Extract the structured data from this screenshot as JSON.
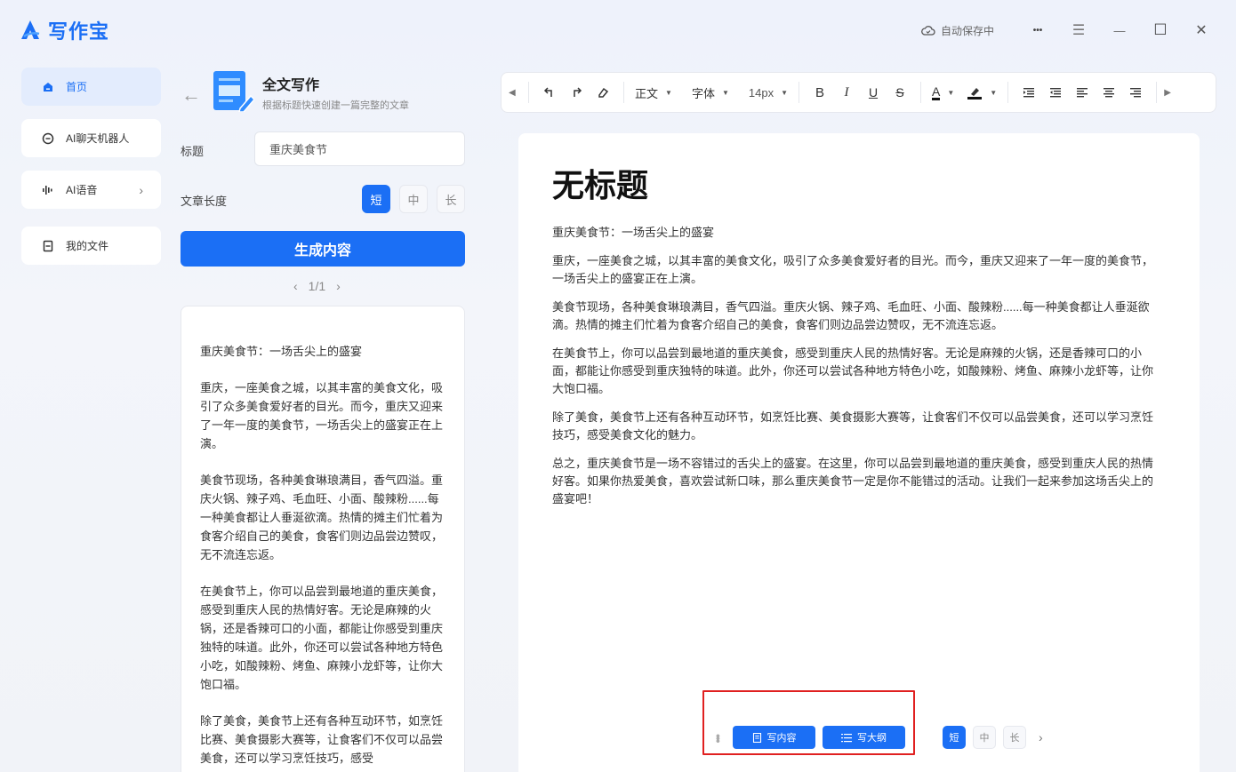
{
  "app": {
    "name": "写作宝"
  },
  "titlebar": {
    "autosave": "自动保存中",
    "more": "•••",
    "menu": "☰",
    "minimize": "—",
    "maximize": "☐",
    "close": "✕"
  },
  "sidebar": {
    "items": [
      {
        "label": "首页"
      },
      {
        "label": "AI聊天机器人"
      },
      {
        "label": "AI语音"
      },
      {
        "label": "我的文件"
      }
    ]
  },
  "panel": {
    "title": "全文写作",
    "subtitle": "根据标题快速创建一篇完整的文章",
    "title_label": "标题",
    "title_value": "重庆美食节",
    "length_label": "文章长度",
    "length_options": [
      "短",
      "中",
      "长"
    ],
    "generate_label": "生成内容",
    "pager": "1/1"
  },
  "result": {
    "paragraphs": [
      "重庆美食节：一场舌尖上的盛宴",
      "重庆，一座美食之城，以其丰富的美食文化，吸引了众多美食爱好者的目光。而今，重庆又迎来了一年一度的美食节，一场舌尖上的盛宴正在上演。",
      "美食节现场，各种美食琳琅满目，香气四溢。重庆火锅、辣子鸡、毛血旺、小面、酸辣粉......每一种美食都让人垂涎欲滴。热情的摊主们忙着为食客介绍自己的美食，食客们则边品尝边赞叹，无不流连忘返。",
      "在美食节上，你可以品尝到最地道的重庆美食，感受到重庆人民的热情好客。无论是麻辣的火锅，还是香辣可口的小面，都能让你感受到重庆独特的味道。此外，你还可以尝试各种地方特色小吃，如酸辣粉、烤鱼、麻辣小龙虾等，让你大饱口福。",
      "除了美食，美食节上还有各种互动环节，如烹饪比赛、美食摄影大赛等，让食客们不仅可以品尝美食，还可以学习烹饪技巧，感受"
    ]
  },
  "toolbar": {
    "paragraph_style": "正文",
    "font": "字体",
    "font_size": "14px"
  },
  "editor": {
    "title": "无标题",
    "paragraphs": [
      "重庆美食节：一场舌尖上的盛宴",
      "重庆，一座美食之城，以其丰富的美食文化，吸引了众多美食爱好者的目光。而今，重庆又迎来了一年一度的美食节，一场舌尖上的盛宴正在上演。",
      "美食节现场，各种美食琳琅满目，香气四溢。重庆火锅、辣子鸡、毛血旺、小面、酸辣粉......每一种美食都让人垂涎欲滴。热情的摊主们忙着为食客介绍自己的美食，食客们则边品尝边赞叹，无不流连忘返。",
      "在美食节上，你可以品尝到最地道的重庆美食，感受到重庆人民的热情好客。无论是麻辣的火锅，还是香辣可口的小面，都能让你感受到重庆独特的味道。此外，你还可以尝试各种地方特色小吃，如酸辣粉、烤鱼、麻辣小龙虾等，让你大饱口福。",
      "除了美食，美食节上还有各种互动环节，如烹饪比赛、美食摄影大赛等，让食客们不仅可以品尝美食，还可以学习烹饪技巧，感受美食文化的魅力。",
      "总之，重庆美食节是一场不容错过的舌尖上的盛宴。在这里，你可以品尝到最地道的重庆美食，感受到重庆人民的热情好客。如果你热爱美食，喜欢尝试新口味，那么重庆美食节一定是你不能错过的活动。让我们一起来参加这场舌尖上的盛宴吧！"
    ]
  },
  "float_bar": {
    "write_content": "写内容",
    "write_outline": "写大纲",
    "length_options": [
      "短",
      "中",
      "长"
    ]
  },
  "colors": {
    "accent": "#1b6ff5",
    "highlight": "#e02020"
  }
}
